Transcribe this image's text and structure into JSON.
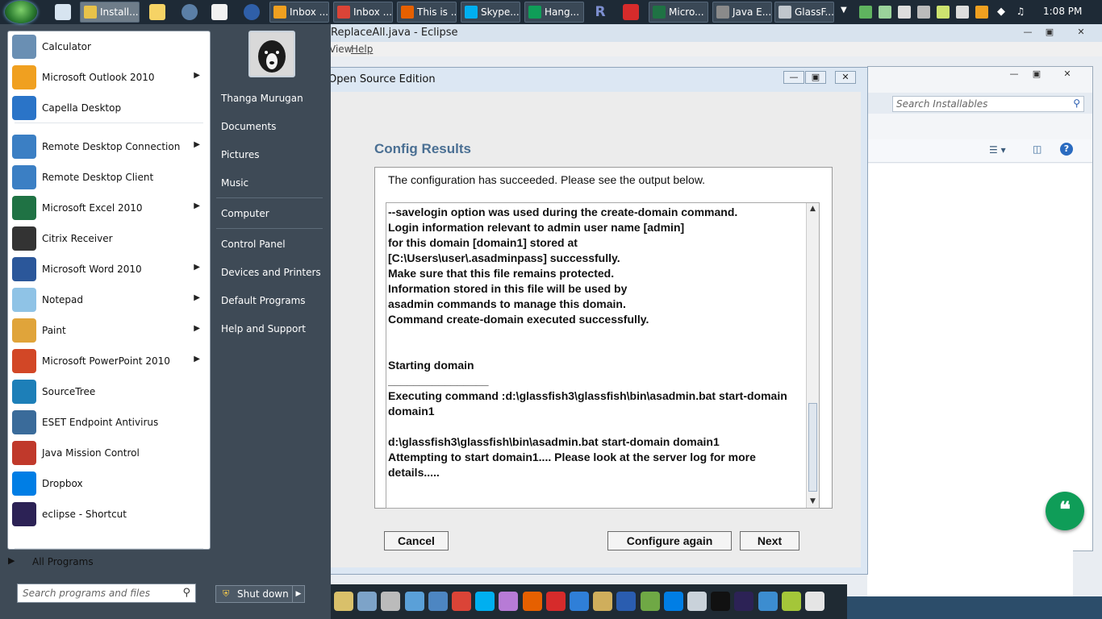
{
  "taskbar": {
    "buttons": [
      {
        "label": "Install...",
        "color": "#e8c24a"
      },
      {
        "label": "Inbox ...",
        "color": "#f0a020"
      },
      {
        "label": "Inbox ...",
        "color": "#db4437"
      },
      {
        "label": "This is ...",
        "color": "#e66000"
      },
      {
        "label": "Skype...",
        "color": "#00aff0"
      },
      {
        "label": "Hang...",
        "color": "#0f9d58"
      },
      {
        "label": "Micro...",
        "color": "#1f7244"
      },
      {
        "label": "Java E...",
        "color": "#8a8a8a"
      },
      {
        "label": "GlassF...",
        "color": "#c0c6cc"
      }
    ],
    "clock": "1:08 PM"
  },
  "eclipse_window": {
    "title": "ReplaceAll.java - Eclipse",
    "menu_view": "View",
    "menu_help": "Help"
  },
  "glassfish_window": {
    "search_placeholder": "Search Installables"
  },
  "dialog": {
    "title": "Open Source Edition",
    "heading": "Config Results",
    "message": "The configuration has succeeded. Please see the output below.",
    "output_lines": [
      "--savelogin option was used during the create-domain command.",
      "Login information relevant to admin user name [admin]",
      "for this domain [domain1] stored at",
      "[C:\\Users\\user\\.asadminpass] successfully.",
      "Make sure that this file remains protected.",
      "Information stored in this file will be used by",
      "asadmin commands to manage this domain.",
      "Command create-domain executed successfully.",
      "",
      "",
      "Starting domain",
      "________________",
      "Executing command :d:\\glassfish3\\glassfish\\bin\\asadmin.bat start-domain",
      "domain1",
      "",
      "d:\\glassfish3\\glassfish\\bin\\asadmin.bat start-domain domain1",
      "Attempting to start domain1.... Please look at the server log for more",
      "details....."
    ],
    "buttons": {
      "cancel": "Cancel",
      "configure_again": "Configure again",
      "next": "Next"
    }
  },
  "start_menu": {
    "programs": [
      {
        "label": "Calculator",
        "icon": "calculator-icon",
        "color": "#6a8fb3",
        "submenu": false
      },
      {
        "label": "Microsoft Outlook 2010",
        "icon": "outlook-icon",
        "color": "#f0a020",
        "submenu": true
      },
      {
        "label": "Capella Desktop",
        "icon": "capella-icon",
        "color": "#2a74c8",
        "submenu": false
      },
      {
        "label": "Remote Desktop Connection",
        "icon": "remote-desktop-icon",
        "color": "#3b7fc4",
        "submenu": true
      },
      {
        "label": "Remote Desktop Client",
        "icon": "remote-client-icon",
        "color": "#3b7fc4",
        "submenu": false
      },
      {
        "label": "Microsoft Excel 2010",
        "icon": "excel-icon",
        "color": "#1f7244",
        "submenu": true
      },
      {
        "label": "Citrix Receiver",
        "icon": "citrix-icon",
        "color": "#333333",
        "submenu": false
      },
      {
        "label": "Microsoft Word 2010",
        "icon": "word-icon",
        "color": "#2b579a",
        "submenu": true
      },
      {
        "label": "Notepad",
        "icon": "notepad-icon",
        "color": "#8fc3e6",
        "submenu": true
      },
      {
        "label": "Paint",
        "icon": "paint-icon",
        "color": "#e0a43a",
        "submenu": true
      },
      {
        "label": "Microsoft PowerPoint 2010",
        "icon": "powerpoint-icon",
        "color": "#d24726",
        "submenu": true
      },
      {
        "label": "SourceTree",
        "icon": "sourcetree-icon",
        "color": "#1d7fb8",
        "submenu": false
      },
      {
        "label": "ESET Endpoint Antivirus",
        "icon": "eset-icon",
        "color": "#3a6b9a",
        "submenu": false
      },
      {
        "label": "Java Mission Control",
        "icon": "java-icon",
        "color": "#c0392b",
        "submenu": false
      },
      {
        "label": "Dropbox",
        "icon": "dropbox-icon",
        "color": "#007ee5",
        "submenu": false
      },
      {
        "label": "eclipse - Shortcut",
        "icon": "eclipse-icon",
        "color": "#2c2255",
        "submenu": false
      }
    ],
    "all_programs": "All Programs",
    "search_placeholder": "Search programs and files",
    "user_name": "Thanga Murugan",
    "right_items": [
      "Documents",
      "Pictures",
      "Music",
      "Computer",
      "Control Panel",
      "Devices and Printers",
      "Default Programs",
      "Help and Support"
    ],
    "shutdown": "Shut down"
  }
}
